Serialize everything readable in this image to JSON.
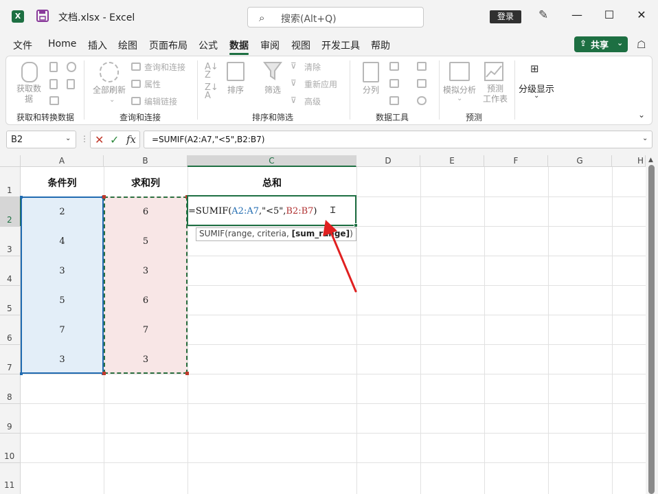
{
  "titlebar": {
    "app_icon": "X",
    "title": "文档.xlsx  -  Excel",
    "search_placeholder": "搜索(Alt+Q)",
    "login": "登录",
    "minimize": "—",
    "maximize": "☐",
    "close": "✕"
  },
  "menu": {
    "tabs": [
      "文件",
      "Home",
      "插入",
      "绘图",
      "页面布局",
      "公式",
      "数据",
      "审阅",
      "视图",
      "开发工具",
      "帮助"
    ],
    "active": "数据",
    "share": "共享"
  },
  "ribbon": {
    "get_data": "获取数\n据",
    "refresh_all": "全部刷新",
    "queries": "查询和连接",
    "properties": "属性",
    "edit_links": "编辑链接",
    "sort": "排序",
    "filter": "筛选",
    "clear": "清除",
    "reapply": "重新应用",
    "advanced": "高级",
    "split": "分列",
    "whatif": "模拟分析",
    "forecast": "预测\n工作表",
    "outline": "分级显示",
    "groups": [
      "获取和转换数据",
      "查询和连接",
      "排序和筛选",
      "数据工具",
      "预测"
    ]
  },
  "formula_bar": {
    "name_box": "B2",
    "formula": "=SUMIF(A2:A7,\"<5\",B2:B7)"
  },
  "sheet": {
    "columns": [
      "A",
      "B",
      "C",
      "D",
      "E",
      "F",
      "G",
      "H"
    ],
    "rows": [
      "1",
      "2",
      "3",
      "4",
      "5",
      "6",
      "7",
      "8",
      "9",
      "10",
      "11"
    ],
    "headers": {
      "a1": "条件列",
      "b1": "求和列",
      "c1": "总和"
    },
    "col_a": [
      "2",
      "4",
      "3",
      "5",
      "7",
      "3"
    ],
    "col_b": [
      "6",
      "5",
      "3",
      "6",
      "7",
      "3"
    ],
    "c2_tokens": {
      "t1": "=SUMIF(",
      "t2": "A2:A7",
      "t3": ",\"<5\",",
      "t4": "B2:B7",
      "t5": ")"
    },
    "tooltip": {
      "pre": "SUMIF(range, criteria, ",
      "bold": "[sum_range]",
      "post": ")"
    }
  },
  "colors": {
    "accent": "#1d6f42",
    "range_a": "#1f6ab0",
    "range_b": "#b03030",
    "arrow": "#e02020"
  }
}
